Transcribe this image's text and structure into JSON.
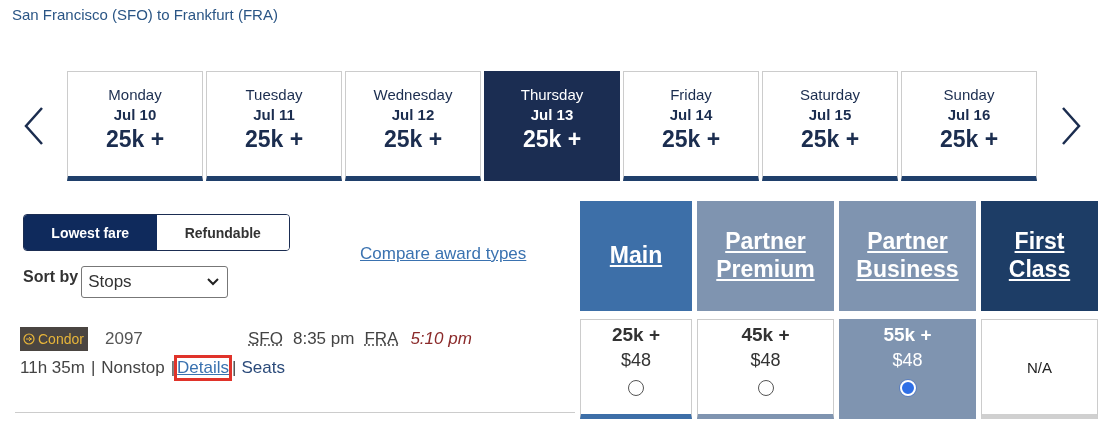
{
  "route_title": "San Francisco (SFO) to Frankfurt (FRA)",
  "dates": [
    {
      "day": "Monday",
      "date": "Jul 10",
      "price": "25k +",
      "selected": false
    },
    {
      "day": "Tuesday",
      "date": "Jul 11",
      "price": "25k +",
      "selected": false
    },
    {
      "day": "Wednesday",
      "date": "Jul 12",
      "price": "25k +",
      "selected": false
    },
    {
      "day": "Thursday",
      "date": "Jul 13",
      "price": "25k +",
      "selected": true
    },
    {
      "day": "Friday",
      "date": "Jul 14",
      "price": "25k +",
      "selected": false
    },
    {
      "day": "Saturday",
      "date": "Jul 15",
      "price": "25k +",
      "selected": false
    },
    {
      "day": "Sunday",
      "date": "Jul 16",
      "price": "25k +",
      "selected": false
    }
  ],
  "fare_toggle": [
    {
      "label": "Lowest fare",
      "selected": true
    },
    {
      "label": "Refundable",
      "selected": false
    }
  ],
  "sort": {
    "label": "Sort by",
    "value": "Stops"
  },
  "compare_link": "Compare award types",
  "flight": {
    "airline": "Condor",
    "number": "2097",
    "origin": "SFO",
    "departure": "8:35 pm",
    "destination": "FRA",
    "arrival": "5:10 pm",
    "duration": "11h 35m",
    "separator_1": "|",
    "stops": "Nonstop",
    "separator_2": "|",
    "details_link": "Details",
    "details_highlighted": true,
    "separator_3": "|",
    "seats_link": "Seats"
  },
  "fare_columns": [
    {
      "name": "Main",
      "color": "#3d6fa8",
      "kind": "fare",
      "miles": "25k +",
      "fee": "$48",
      "selected": false
    },
    {
      "name": "Partner Premium",
      "color": "#7f94b0",
      "kind": "fare",
      "miles": "45k +",
      "fee": "$48",
      "selected": false
    },
    {
      "name": "Partner Business",
      "color": "#7f94b0",
      "kind": "fare",
      "miles": "55k +",
      "fee": "$48",
      "selected": true
    },
    {
      "name": "First Class",
      "color": "#1d3d66",
      "kind": "unavailable",
      "note": "N/A"
    }
  ]
}
